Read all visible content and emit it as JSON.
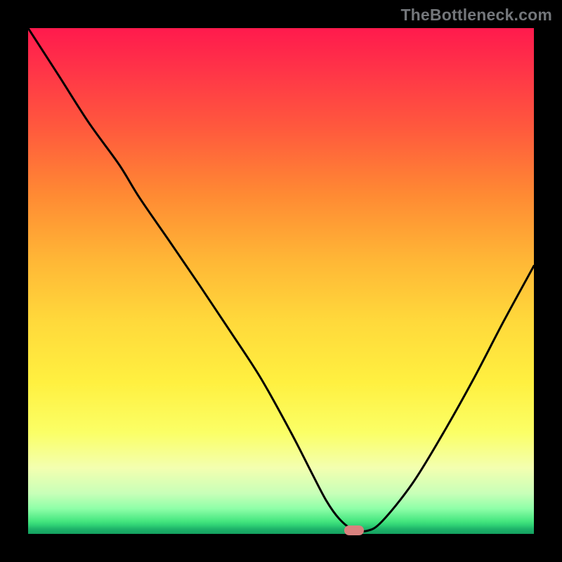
{
  "watermark": "TheBottleneck.com",
  "marker": {
    "x_pct": 64.5,
    "y_pct": 99.3
  },
  "chart_data": {
    "type": "line",
    "title": "",
    "xlabel": "",
    "ylabel": "",
    "xlim": [
      0,
      100
    ],
    "ylim": [
      0,
      100
    ],
    "grid": false,
    "series": [
      {
        "name": "bottleneck-curve",
        "x": [
          0,
          6,
          12,
          18,
          22,
          28,
          34,
          40,
          46,
          52,
          56,
          59,
          61.5,
          64,
          67,
          70,
          76,
          82,
          88,
          94,
          100
        ],
        "y": [
          100,
          90.7,
          81.3,
          73,
          66.5,
          57.8,
          49,
          40,
          30.8,
          20,
          12.2,
          6.5,
          3,
          1,
          0.6,
          2.5,
          10,
          19.8,
          30.5,
          42,
          53
        ]
      }
    ],
    "annotations": [
      {
        "type": "marker",
        "shape": "pill",
        "x": 64.5,
        "y": 0.7,
        "color": "#d9817e"
      }
    ],
    "background_gradient": {
      "direction": "vertical",
      "stops": [
        {
          "pct": 0,
          "color": "#ff1a4d"
        },
        {
          "pct": 33,
          "color": "#ff8a33"
        },
        {
          "pct": 58,
          "color": "#ffd93b"
        },
        {
          "pct": 80,
          "color": "#fbff66"
        },
        {
          "pct": 92,
          "color": "#c8ffb8"
        },
        {
          "pct": 100,
          "color": "#14a060"
        }
      ]
    }
  }
}
